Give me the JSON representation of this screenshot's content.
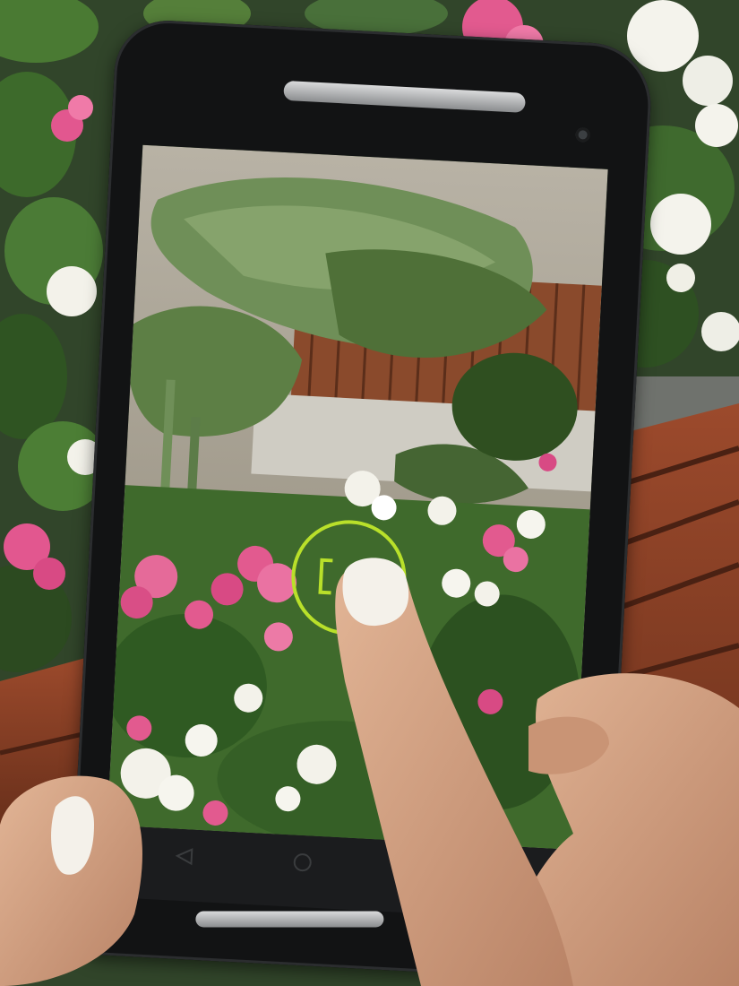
{
  "scene": {
    "description_free": "",
    "colors": {
      "bench": "#8a3e26",
      "foliage": "#3f6a2c",
      "begonia_pink": "#e25a8f",
      "begonia_white": "#f3f2ea",
      "phone_body": "#121314",
      "focus_ring": "#b9e02a",
      "skin": "#d9a887",
      "nail": "#f4f1ea"
    }
  },
  "phone": {
    "screen": {
      "mode": "camera-viewfinder",
      "focus_indicator": "focus-ring-icon"
    },
    "navbar": {
      "back": "back-icon",
      "home": "home-icon",
      "recent": "recent-apps-icon"
    }
  }
}
